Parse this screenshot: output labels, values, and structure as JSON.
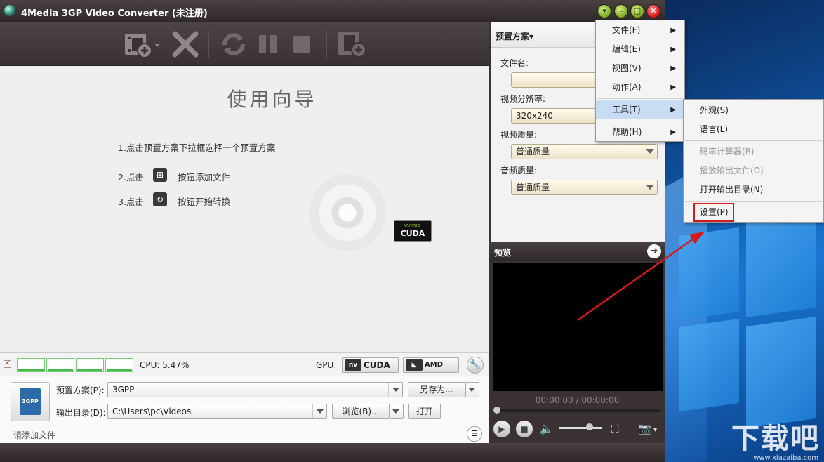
{
  "window": {
    "title": "4Media 3GP Video Converter (未注册)",
    "buttons": {
      "dropdown": "▾",
      "minimize": "–",
      "maximize": "□",
      "close": "✕"
    }
  },
  "toolbar": {
    "icons": [
      "add-file-icon",
      "delete-icon",
      "convert-icon",
      "pause-icon",
      "stop-icon",
      "add-segment-icon"
    ]
  },
  "guide": {
    "heading": "使用向导",
    "step1": "1.点击预置方案下拉框选择一个预置方案",
    "step2_prefix": "2.点击",
    "step2_suffix": "按钮添加文件",
    "step3_prefix": "3.点击",
    "step3_suffix": "按钮开始转换",
    "cuda_brand": "NVIDIA.",
    "cuda_text": "CUDA"
  },
  "status": {
    "cpu": "CPU: 5.47%",
    "gpu_label": "GPU:",
    "cuda_button": "CUDA",
    "amd_button": "AMD APP"
  },
  "bottom": {
    "preset_label": "预置方案(P):",
    "preset_value": "3GPP",
    "save_as": "另存为...",
    "output_label": "输出目录(D):",
    "output_value": "C:\\Users\\pc\\Videos",
    "browse": "浏览(B)...",
    "open": "打开",
    "hint": "请添加文件",
    "thumb_text": "3GPP"
  },
  "preset_panel": {
    "header": "预置方案▾",
    "filename_label": "文件名:",
    "filename_value": "",
    "resolution_label": "视频分辨率:",
    "resolution_value": "320x240",
    "video_quality_label": "视频质量:",
    "video_quality_value": "普通质量",
    "audio_quality_label": "音频质量:",
    "audio_quality_value": "普通质量"
  },
  "preview": {
    "header": "预览",
    "time": "00:00:00 / 00:00:00"
  },
  "main_menu": [
    {
      "label": "文件(F)",
      "submenu": true
    },
    {
      "label": "编辑(E)",
      "submenu": true
    },
    {
      "label": "视图(V)",
      "submenu": true
    },
    {
      "label": "动作(A)",
      "submenu": true
    },
    {
      "label": "工具(T)",
      "submenu": true,
      "highlighted": true
    },
    {
      "label": "帮助(H)",
      "submenu": true
    }
  ],
  "tools_menu": [
    {
      "label": "外观(S)",
      "enabled": true
    },
    {
      "label": "语言(L)",
      "enabled": true
    },
    {
      "label": "码率计算器(B)",
      "enabled": false
    },
    {
      "label": "播放输出文件(O)",
      "enabled": false
    },
    {
      "label": "打开输出目录(N)",
      "enabled": true
    },
    {
      "label": "设置(P)",
      "enabled": true,
      "annotated": true
    }
  ],
  "desktop": {
    "watermark": "下载吧",
    "watermark_url": "www.xiazaiba.com"
  },
  "colors": {
    "annotation": "#d41a1a",
    "menu_highlight": "#c8dcf4"
  }
}
